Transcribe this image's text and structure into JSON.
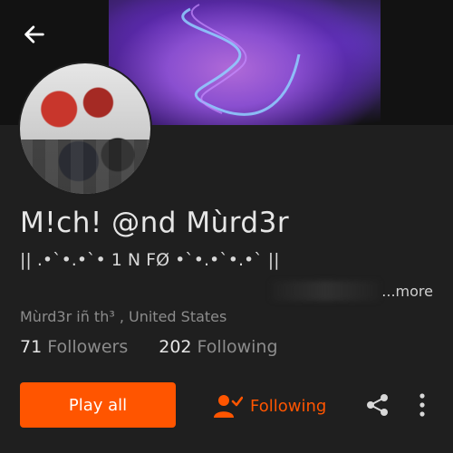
{
  "profile": {
    "username": "M!ch! @nd Mùrd3r",
    "bio": "|| .•`•.•`• 1 N FØ •`•.•`•.•` ||",
    "more_label": "...more",
    "location": "Mùrd3r iñ th³ , United States"
  },
  "stats": {
    "followers_count": "71",
    "followers_label": "Followers",
    "following_count": "202",
    "following_label": "Following"
  },
  "actions": {
    "play_all_label": "Play all",
    "following_label": "Following"
  },
  "colors": {
    "accent": "#ff5500",
    "background": "#1f1f1f",
    "muted_text": "#8c8c8c"
  },
  "icons": {
    "back": "arrow-left-icon",
    "follow": "user-check-icon",
    "share": "share-icon",
    "more": "more-vertical-icon"
  }
}
